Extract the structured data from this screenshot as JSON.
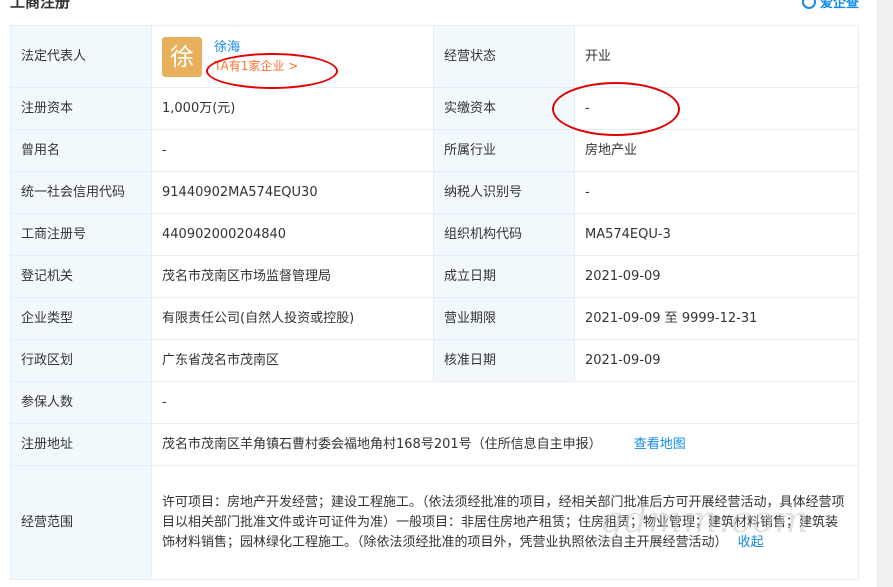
{
  "header": {
    "title": "工商注册",
    "brand": "爱企查"
  },
  "rows": {
    "legal_rep": {
      "label": "法定代表人",
      "avatar_char": "徐",
      "name": "徐海",
      "firms": "TA有1家企业 >"
    },
    "status": {
      "label": "经营状态",
      "value": "开业"
    },
    "reg_capital": {
      "label": "注册资本",
      "value": "1,000万(元)"
    },
    "paid_capital": {
      "label": "实缴资本",
      "value": "-"
    },
    "former_name": {
      "label": "曾用名",
      "value": "-"
    },
    "industry": {
      "label": "所属行业",
      "value": "房地产业"
    },
    "credit_code": {
      "label": "统一社会信用代码",
      "value": "91440902MA574EQU30"
    },
    "taxpayer_id": {
      "label": "纳税人识别号",
      "value": "-"
    },
    "reg_no": {
      "label": "工商注册号",
      "value": "440902000204840"
    },
    "org_code": {
      "label": "组织机构代码",
      "value": "MA574EQU-3"
    },
    "authority": {
      "label": "登记机关",
      "value": "茂名市茂南区市场监督管理局"
    },
    "found_date": {
      "label": "成立日期",
      "value": "2021-09-09"
    },
    "company_type": {
      "label": "企业类型",
      "value": "有限责任公司(自然人投资或控股)"
    },
    "biz_term": {
      "label": "营业期限",
      "value": "2021-09-09 至 9999-12-31"
    },
    "region": {
      "label": "行政区划",
      "value": "广东省茂名市茂南区"
    },
    "approve_date": {
      "label": "核准日期",
      "value": "2021-09-09"
    },
    "insured": {
      "label": "参保人数",
      "value": "-"
    },
    "address": {
      "label": "注册地址",
      "value": "茂名市茂南区羊角镇石曹村委会福地角村168号201号（住所信息自主申报）",
      "map_link": "查看地图"
    },
    "scope": {
      "label": "经营范围",
      "value": "许可项目：房地产开发经营；建设工程施工。（依法须经批准的项目，经相关部门批准后方可开展经营活动，具体经营项目以相关部门批准文件或许可证件为准）一般项目：非居住房地产租赁；住房租赁；物业管理；建筑材料销售；建筑装饰材料销售；园林绿化工程施工。（除依法须经批准的项目外，凭营业执照依法自主开展经营活动）",
      "collapse": "收起"
    }
  },
  "watermark": "gdmm.com",
  "colors": {
    "label_bg": "#f2f9fc",
    "link": "#128bed",
    "highlight": "#ff722d",
    "annotation": "#e30000"
  }
}
